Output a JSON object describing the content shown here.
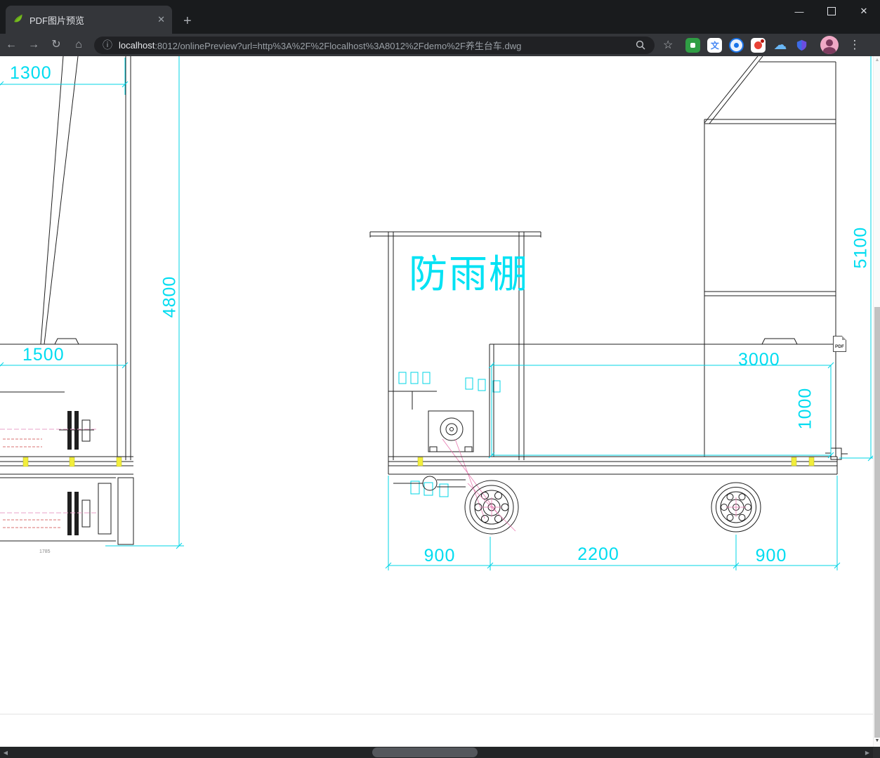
{
  "window": {
    "minimize_glyph": "—",
    "close_glyph": "✕"
  },
  "tab": {
    "title": "PDF图片预览",
    "close_glyph": "✕",
    "new_tab_glyph": "+"
  },
  "toolbar": {
    "back_glyph": "←",
    "forward_glyph": "→",
    "reload_glyph": "↻",
    "home_glyph": "⌂",
    "info_glyph": "ⓘ",
    "url": {
      "host": "localhost",
      "rest": ":8012/onlinePreview?url=http%3A%2F%2Flocalhost%3A8012%2Fdemo%2F养生台车.dwg"
    },
    "star_glyph": "☆",
    "menu_glyph": "⋮"
  },
  "extensions": [
    {
      "name": "green-extension"
    },
    {
      "name": "translate-extension",
      "glyph": "文"
    },
    {
      "name": "blue-circle-extension"
    },
    {
      "name": "red-badge-extension"
    },
    {
      "name": "cloud-extension",
      "glyph": "☁"
    },
    {
      "name": "shield-extension"
    }
  ],
  "scrollbar": {
    "up": "▲",
    "down": "▼",
    "left": "◀",
    "right": "▶"
  },
  "drawing": {
    "shelter_label": "防雨棚",
    "pdf_badge": "PDF",
    "dims": {
      "d1300": "1300",
      "d4800": "4800",
      "d1500": "1500",
      "d1785": "1785",
      "d5100": "5100",
      "d3000": "3000",
      "d1000": "1000",
      "d900_left": "900",
      "d2200": "2200",
      "d900_right": "900"
    },
    "colors": {
      "dimension_cyan": "#00d4e6",
      "highlight_yellow": "#f2ee3c",
      "centerline_pink": "#e8a0c8",
      "hidden_red": "#cc4444"
    }
  }
}
